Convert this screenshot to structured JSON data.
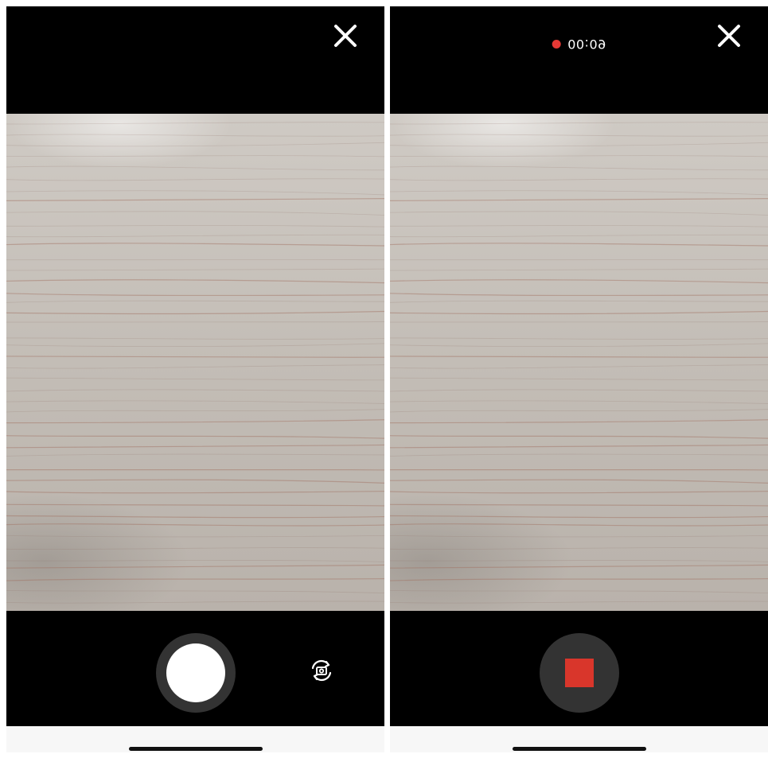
{
  "screens": {
    "capture": {
      "close_icon": "close-icon",
      "shutter_icon": "shutter-button",
      "flip_icon": "switch-camera-icon"
    },
    "recording": {
      "indicator_color": "#e53935",
      "timer": "00:09",
      "close_icon": "close-icon",
      "stop_icon": "stop-icon",
      "stop_color": "#d9362b"
    }
  }
}
